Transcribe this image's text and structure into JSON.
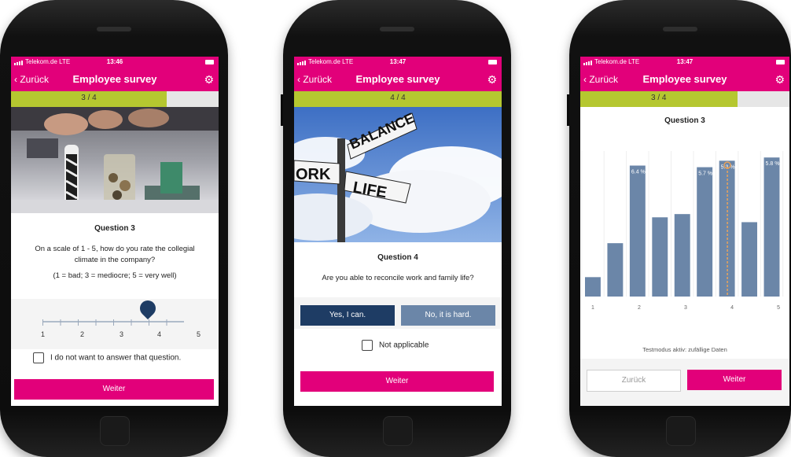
{
  "status_bar": {
    "carrier": "Telekom.de LTE",
    "time1": "13:46",
    "time2": "13:47",
    "time3": "13:47"
  },
  "header": {
    "back": "Zurück",
    "title": "Employee survey",
    "settings_icon": "gear-icon"
  },
  "screen1": {
    "progress_text": "3 / 4",
    "progress_fraction": 0.75,
    "question_title": "Question 3",
    "question_text": "On a scale of 1 - 5, how do you rate the collegial climate in the company?",
    "scale_hint": "(1 = bad; 3 = mediocre; 5 = very well)",
    "slider_value": 4,
    "slider_labels": [
      "1",
      "2",
      "3",
      "4",
      "5"
    ],
    "opt_out_label": "I do not want to answer that question.",
    "next_button": "Weiter"
  },
  "screen2": {
    "progress_text": "4 / 4",
    "progress_fraction": 1.0,
    "sign_words": [
      "BALANCE",
      "ORK",
      "LIFE"
    ],
    "question_title": "Question 4",
    "question_text": "Are you able to reconcile work and family life?",
    "yes_button": "Yes, I can.",
    "no_button": "No, it is hard.",
    "not_applicable": "Not applicable",
    "next_button": "Weiter"
  },
  "screen3": {
    "progress_text": "3 / 4",
    "progress_fraction": 0.75,
    "chart_title": "Question 3",
    "footnote": "Testmodus aktiv: zufällige Daten",
    "back_button": "Zurück",
    "next_button": "Weiter"
  },
  "chart_data": {
    "type": "bar",
    "title": "Question 3",
    "x_tick_labels": [
      "1",
      "2",
      "3",
      "4",
      "5"
    ],
    "values": [
      1.2,
      3.3,
      8.1,
      4.9,
      5.1,
      8.0,
      8.4,
      4.6,
      8.6
    ],
    "data_labels": [
      {
        "index": 2,
        "label": "6.4 %"
      },
      {
        "index": 5,
        "label": "5.7 %"
      },
      {
        "index": 6,
        "label": "5.3 %"
      },
      {
        "index": 8,
        "label": "5.8 %"
      }
    ],
    "marker_at": 3.9,
    "bar_color": "#6b86a8",
    "marker_color": "#e8a25a"
  },
  "colors": {
    "brand": "#e2007a",
    "progress": "#b5c730",
    "yes_button": "#1e3c64",
    "no_button": "#6b86a8"
  }
}
